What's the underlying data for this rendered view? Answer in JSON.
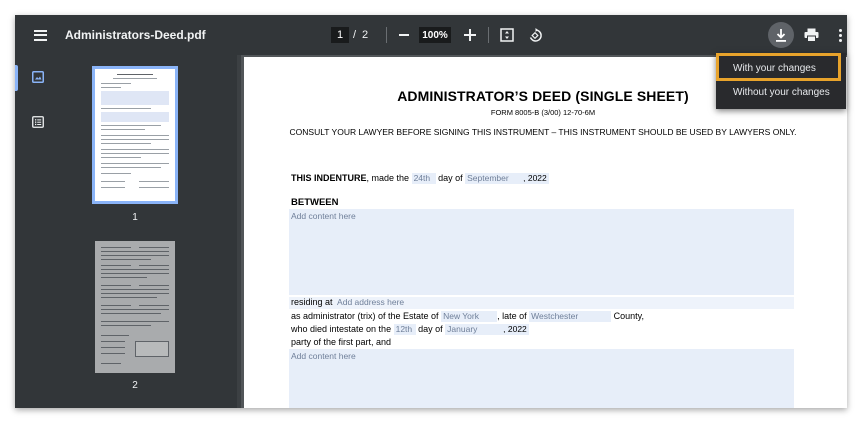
{
  "viewer": {
    "title": "Administrators-Deed.pdf",
    "current_page": "1",
    "page_separator": "/",
    "total_pages": "2",
    "zoom": "100%",
    "icons": {
      "menu": "menu-icon",
      "zoom_out": "minus-icon",
      "zoom_in": "plus-icon",
      "fit": "fit-page-icon",
      "rotate": "rotate-icon",
      "download": "download-icon",
      "print": "print-icon",
      "more": "more-vert-icon",
      "thumbnails": "thumbnails-icon",
      "outline": "outline-icon"
    },
    "colors": {
      "toolbar": "#323639",
      "canvas": "#525659",
      "accent": "#8ab4f8",
      "highlight": "#e8a32b"
    }
  },
  "thumbnails": [
    {
      "label": "1",
      "selected": true
    },
    {
      "label": "2",
      "selected": false
    }
  ],
  "download_menu": {
    "with_changes": "With your changes",
    "without_changes": "Without your changes"
  },
  "document": {
    "title": "ADMINISTRATOR’S DEED (SINGLE SHEET)",
    "form": "FORM 8005-B (3/00) 12-70-6M",
    "consult": "CONSULT YOUR LAWYER BEFORE SIGNING THIS INSTRUMENT – THIS INSTRUMENT SHOULD BE USED BY LAWYERS ONLY.",
    "indenture_label": "THIS INDENTURE",
    "made_the": ", made the",
    "day_value": "24th",
    "day_of": "day of",
    "month_value": "September",
    "year_value": ", 2022",
    "between": "BETWEEN",
    "content_placeholder_1": "Add content here",
    "residing_at": "residing at",
    "address_placeholder": "Add address here",
    "admin_text": "as administrator (trix) of the Estate of",
    "estate_value": "New York",
    "late_of": ", late of",
    "late_of_value": "Westchester",
    "county": "County,",
    "died_text": "who died intestate on the",
    "died_day": "12th",
    "died_day_of": "day of",
    "died_month": "January",
    "died_year": ", 2022",
    "party_text": "party of the first part, and",
    "content_placeholder_2": "Add content here"
  }
}
